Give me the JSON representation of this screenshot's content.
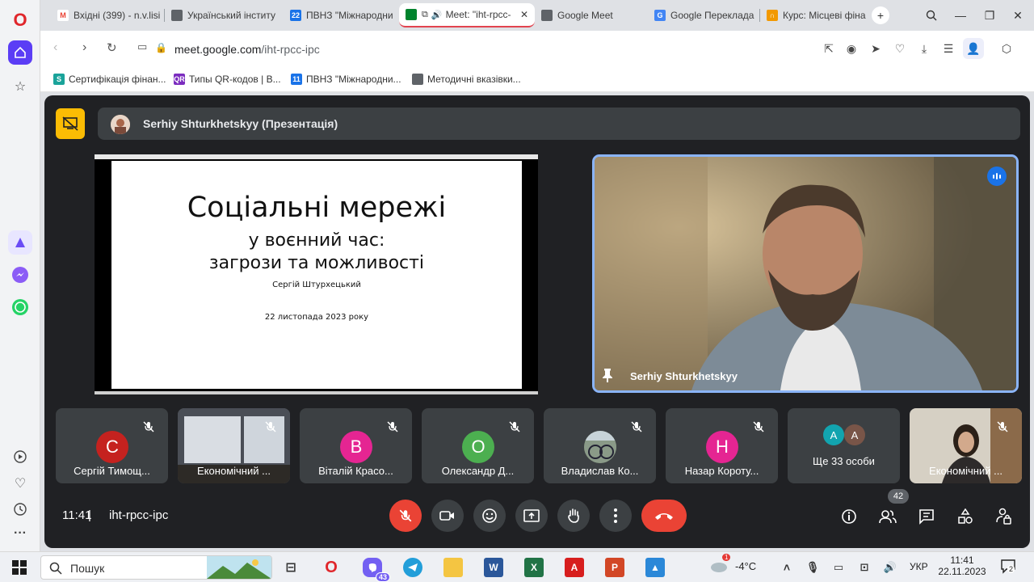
{
  "browser": {
    "tabs": [
      {
        "label": "Вхідні (399) - n.v.lisi"
      },
      {
        "label": "Український інститу"
      },
      {
        "label": "ПВНЗ \"Міжнародни"
      },
      {
        "label": "Meet: \"iht-rpcc-"
      },
      {
        "label": "Google Meet"
      },
      {
        "label": "Google Переклада"
      },
      {
        "label": "Курс: Місцеві фіна"
      }
    ],
    "url_host": "meet.google.com",
    "url_path": "/iht-rpcc-ipc",
    "bookmarks": [
      {
        "label": "Сертифікація фінан..."
      },
      {
        "label": "Типы QR-кодов | В..."
      },
      {
        "label": "ПВНЗ \"Міжнародни..."
      },
      {
        "label": "Методичні вказівки..."
      }
    ]
  },
  "meet": {
    "presenter_banner": "Serhiy Shturkhetskyy (Презентація)",
    "slide": {
      "title": "Соціальні мережі",
      "subtitle1": "у воєнний час:",
      "subtitle2": "загрози та можливості",
      "author": "Сергій Штурхецький",
      "date": "22 листопада 2023 року"
    },
    "camera_name": "Serhiy Shturkhetskyy",
    "participants": [
      {
        "initial": "С",
        "name": "Сергій Тимощ...",
        "color": "#c5221f"
      },
      {
        "initial": "",
        "name": "Економічний ...",
        "color": ""
      },
      {
        "initial": "В",
        "name": "Віталій Красо...",
        "color": "#e52592"
      },
      {
        "initial": "О",
        "name": "Олександр Д...",
        "color": "#4caf50"
      },
      {
        "initial": "",
        "name": "Владислав Ко...",
        "color": ""
      },
      {
        "initial": "Н",
        "name": "Назар Короту...",
        "color": "#e52592"
      },
      {
        "initial": "",
        "name": "Ще 33 особи",
        "color": ""
      },
      {
        "initial": "",
        "name": "Економічний ...",
        "color": ""
      }
    ],
    "more_initials": [
      "А",
      "А"
    ],
    "time": "11:41",
    "meeting_code": "iht-rpcc-ipc",
    "people_count": "42"
  },
  "taskbar": {
    "search_placeholder": "Пошук",
    "viber_badge": "43",
    "weather": "-4°C",
    "weather_badge": "1",
    "lang": "УКР",
    "clock_time": "11:41",
    "clock_date": "22.11.2023",
    "notif_count": "2"
  }
}
